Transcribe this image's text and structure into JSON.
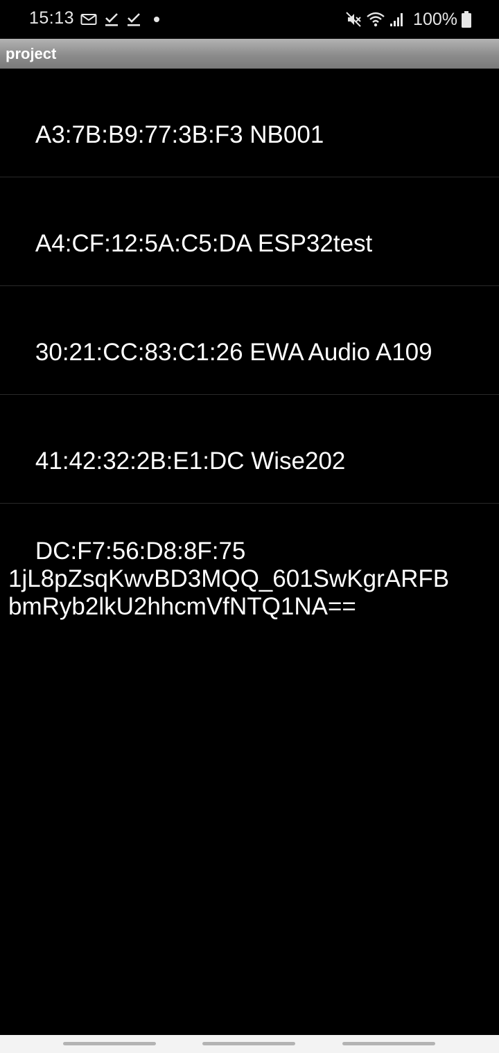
{
  "status_bar": {
    "time": "15:13",
    "left_icons": [
      "gmail-icon",
      "download-check-icon",
      "download-check-icon",
      "notification-dot-icon"
    ],
    "right_icons": [
      "mute-icon",
      "wifi-icon",
      "signal-icon"
    ],
    "battery": "100%"
  },
  "app_bar": {
    "title": "project"
  },
  "devices": [
    {
      "label": "A3:7B:B9:77:3B:F3 NB001"
    },
    {
      "label": "A4:CF:12:5A:C5:DA ESP32test"
    },
    {
      "label": "30:21:CC:83:C1:26 EWA Audio A109"
    },
    {
      "label": "41:42:32:2B:E1:DC Wise202"
    },
    {
      "label": "DC:F7:56:D8:8F:75\n1jL8pZsqKwvBD3MQQ_601SwKgrARFB\nbmRyb2lkU2hhcmVfNTQ1NA=="
    }
  ],
  "colors": {
    "background": "#000000",
    "app_bar": "#9a9a9a",
    "text": "#ffffff",
    "divider": "#2a2a2a",
    "nav_bar": "#f3f3f3"
  }
}
